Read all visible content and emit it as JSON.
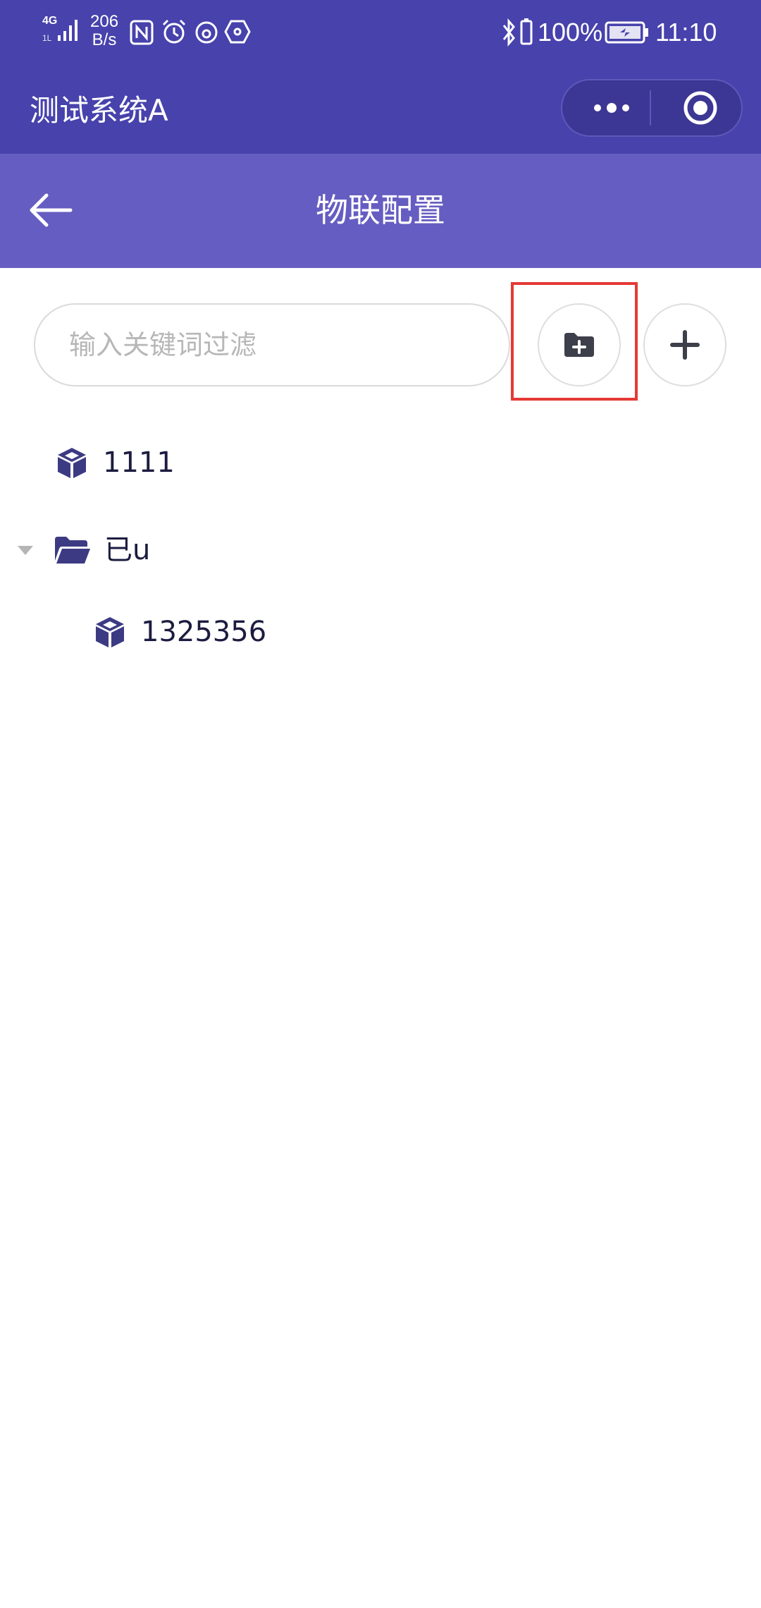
{
  "status_bar": {
    "network": "4G",
    "network_sub": "1L",
    "speed_value": "206",
    "speed_unit": "B/s",
    "battery_percent": "100%",
    "time": "11:10"
  },
  "app_bar": {
    "title": "测试系统A"
  },
  "header": {
    "title": "物联配置"
  },
  "search": {
    "placeholder": "输入关键词过滤",
    "value": ""
  },
  "tree": [
    {
      "label": "1111",
      "type": "device"
    },
    {
      "label": "已u",
      "type": "folder",
      "expanded": true,
      "children": [
        {
          "label": "1325356",
          "type": "device"
        }
      ]
    }
  ],
  "colors": {
    "app_bar": "#4742ac",
    "header": "#665dc2",
    "icon": "#3d3a84",
    "highlight": "#e53935"
  }
}
